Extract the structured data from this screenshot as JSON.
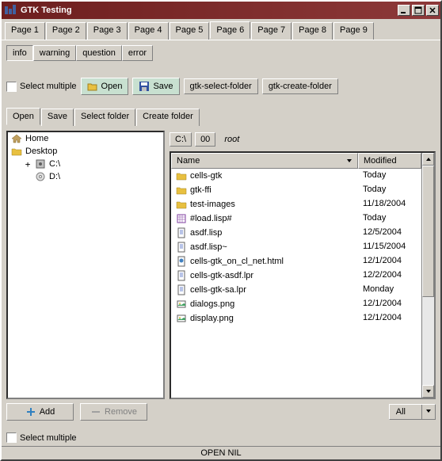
{
  "window": {
    "title": "GTK Testing"
  },
  "pagetabs": [
    "Page 1",
    "Page 2",
    "Page 3",
    "Page 4",
    "Page 5",
    "Page 6",
    "Page 7",
    "Page 8",
    "Page 9"
  ],
  "pagetabs_active": 5,
  "msgtabs": [
    "info",
    "warning",
    "question",
    "error"
  ],
  "msgtabs_active": 0,
  "toolbar": {
    "select_multiple": "Select multiple",
    "open": "Open",
    "save": "Save",
    "gtk_select_folder": "gtk-select-folder",
    "gtk_create_folder": "gtk-create-folder"
  },
  "optabs": [
    "Open",
    "Save",
    "Select folder",
    "Create folder"
  ],
  "optabs_active": 0,
  "tree": [
    {
      "label": "Home",
      "icon": "home",
      "indent": 0,
      "expander": ""
    },
    {
      "label": "Desktop",
      "icon": "folder",
      "indent": 0,
      "expander": ""
    },
    {
      "label": "C:\\",
      "icon": "disk",
      "indent": 1,
      "expander": "+"
    },
    {
      "label": "D:\\",
      "icon": "disc",
      "indent": 1,
      "expander": ""
    }
  ],
  "path": {
    "drive": "C:\\",
    "segment": "00",
    "root": "root"
  },
  "columns": {
    "name": "Name",
    "modified": "Modified"
  },
  "files": [
    {
      "name": "cells-gtk",
      "icon": "folder",
      "modified": "Today"
    },
    {
      "name": "gtk-ffi",
      "icon": "folder",
      "modified": "Today"
    },
    {
      "name": "test-images",
      "icon": "folder",
      "modified": "11/18/2004"
    },
    {
      "name": "#load.lisp#",
      "icon": "grid",
      "modified": "Today"
    },
    {
      "name": "asdf.lisp",
      "icon": "doc",
      "modified": "12/5/2004"
    },
    {
      "name": "asdf.lisp~",
      "icon": "doc",
      "modified": "11/15/2004"
    },
    {
      "name": "cells-gtk_on_cl_net.html",
      "icon": "html",
      "modified": "12/1/2004"
    },
    {
      "name": "cells-gtk-asdf.lpr",
      "icon": "doc",
      "modified": "12/2/2004"
    },
    {
      "name": "cells-gtk-sa.lpr",
      "icon": "doc",
      "modified": "Monday"
    },
    {
      "name": "dialogs.png",
      "icon": "img",
      "modified": "12/1/2004"
    },
    {
      "name": "display.png",
      "icon": "img",
      "modified": "12/1/2004"
    }
  ],
  "bottom": {
    "add": "Add",
    "remove": "Remove",
    "filter": "All"
  },
  "status_check": "Select multiple",
  "statusbar": "OPEN NIL"
}
